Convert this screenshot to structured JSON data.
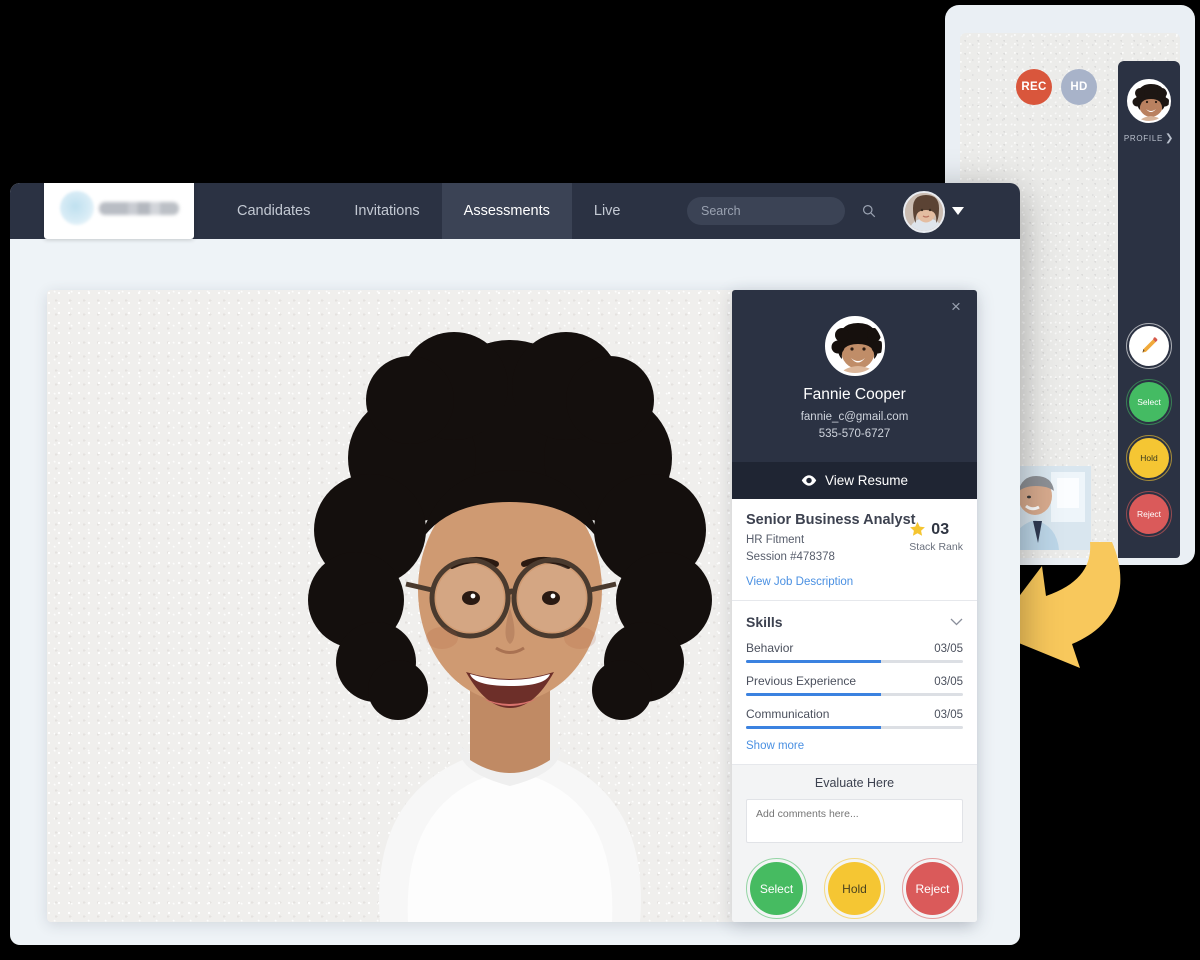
{
  "device_panel": {
    "badges": [
      {
        "name": "rec-badge",
        "label": "REC",
        "color": "#d9563c"
      },
      {
        "name": "hd-badge",
        "label": "HD",
        "color": "#a8b3c9"
      }
    ],
    "profile_label": "PROFILE",
    "profile_chevron": "❯",
    "actions": [
      {
        "name": "edit",
        "label": "",
        "icon": "pencil-icon",
        "color": "#ffffff"
      },
      {
        "name": "select",
        "label": "Select",
        "color": "#44bb63"
      },
      {
        "name": "hold",
        "label": "Hold",
        "color": "#f5c633"
      },
      {
        "name": "reject",
        "label": "Reject",
        "color": "#da5a5a"
      }
    ]
  },
  "main_window": {
    "topbar": {
      "nav": [
        {
          "label": "Candidates",
          "active": false
        },
        {
          "label": "Invitations",
          "active": false
        },
        {
          "label": "Assessments",
          "active": true
        },
        {
          "label": "Live",
          "active": false
        }
      ],
      "search": {
        "placeholder": "Search",
        "value": ""
      },
      "accent_dark": "#2b3243",
      "accent_active": "#3b4355"
    }
  },
  "detail_card": {
    "close_label": "×",
    "candidate": {
      "name": "Fannie Cooper",
      "email": "fannie_c@gmail.com",
      "phone": "535-570-6727"
    },
    "view_resume": "View Resume",
    "job": {
      "title": "Senior Business Analyst",
      "fitment": "HR Fitment",
      "session": "Session #478378",
      "link": "View Job Description",
      "stack_rank_value": "03",
      "stack_rank_label": "Stack Rank"
    },
    "skills": {
      "title": "Skills",
      "items": [
        {
          "name": "Behavior",
          "score": "03/05",
          "pct": 62
        },
        {
          "name": "Previous Experience",
          "score": "03/05",
          "pct": 62
        },
        {
          "name": "Communication",
          "score": "03/05",
          "pct": 62
        }
      ],
      "show_more": "Show more"
    },
    "evaluate": {
      "title": "Evaluate Here",
      "comment_placeholder": "Add comments here...",
      "comment_value": "",
      "buttons": [
        {
          "label": "Select",
          "color": "#46bb61"
        },
        {
          "label": "Hold",
          "color": "#f5c633"
        },
        {
          "label": "Reject",
          "color": "#da5a5a"
        }
      ]
    }
  },
  "colors": {
    "page_bg": "#000000",
    "window_bg": "#eef3f7",
    "card_dark": "#2b3243",
    "link_blue": "#4a90e2",
    "progress_blue": "#3b82e0",
    "arrow_yellow": "#f8c85c"
  }
}
